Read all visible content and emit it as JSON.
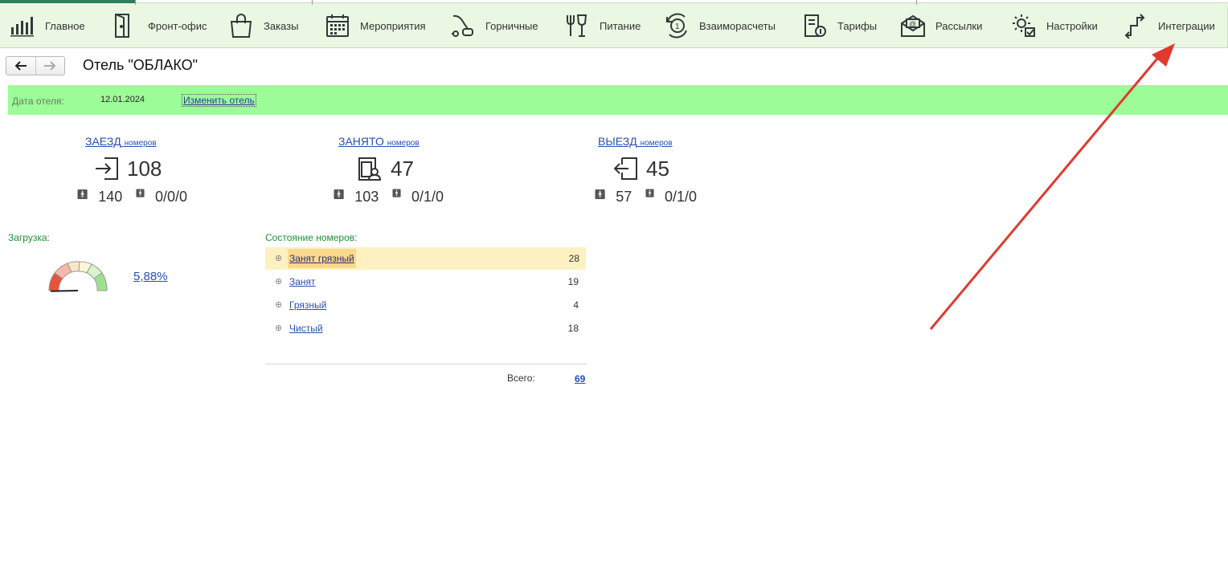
{
  "nav": {
    "items": [
      {
        "label": "Главное",
        "icon": "chart-bars-icon"
      },
      {
        "label": "Фронт-офис",
        "icon": "door-icon"
      },
      {
        "label": "Заказы",
        "icon": "shopping-bag-icon"
      },
      {
        "label": "Мероприятия",
        "icon": "calendar-icon"
      },
      {
        "label": "Горничные",
        "icon": "vacuum-cleaner-icon"
      },
      {
        "label": "Питание",
        "icon": "fork-glass-icon"
      },
      {
        "label": "Взаиморасчеты",
        "icon": "coin-cycle-icon"
      },
      {
        "label": "Тарифы",
        "icon": "tariff-doc-icon"
      },
      {
        "label": "Рассылки",
        "icon": "envelope-at-icon"
      },
      {
        "label": "Настройки",
        "icon": "gears-icon"
      },
      {
        "label": "Интеграции",
        "icon": "integration-arrows-icon"
      }
    ]
  },
  "page": {
    "title": "Отель \"ОБЛАКО\""
  },
  "datebar": {
    "label": "Дата отеля:",
    "value": "12.01.2024",
    "change_link": "Изменить отель"
  },
  "stats": {
    "arrival": {
      "head": "ЗАЕЗД",
      "head_small": "номеров",
      "count": "108",
      "guests": "140",
      "extra": "0/0/0"
    },
    "occupied": {
      "head": "ЗАНЯТО",
      "head_small": "номеров",
      "count": "47",
      "guests": "103",
      "extra": "0/1/0"
    },
    "departure": {
      "head": "ВЫЕЗД",
      "head_small": "номеров",
      "count": "45",
      "guests": "57",
      "extra": "0/1/0"
    }
  },
  "load": {
    "label": "Загрузка:",
    "value": "5,88%",
    "fraction": 0.0588
  },
  "rooms": {
    "label": "Состояние номеров:",
    "rows": [
      {
        "name": "Занят грязный",
        "count": "28"
      },
      {
        "name": "Занят",
        "count": "19"
      },
      {
        "name": "Грязный",
        "count": "4"
      },
      {
        "name": "Чистый",
        "count": "18"
      }
    ],
    "total_label": "Всего:",
    "total_value": "69"
  },
  "colors": {
    "nav_bg": "#eaf7e2",
    "datebar_bg": "#9cfc98",
    "link": "#2a4fb0",
    "section_label": "#1f8f3a",
    "highlight_row": "#fdf1c1",
    "annotation_arrow": "#e03a2f"
  }
}
